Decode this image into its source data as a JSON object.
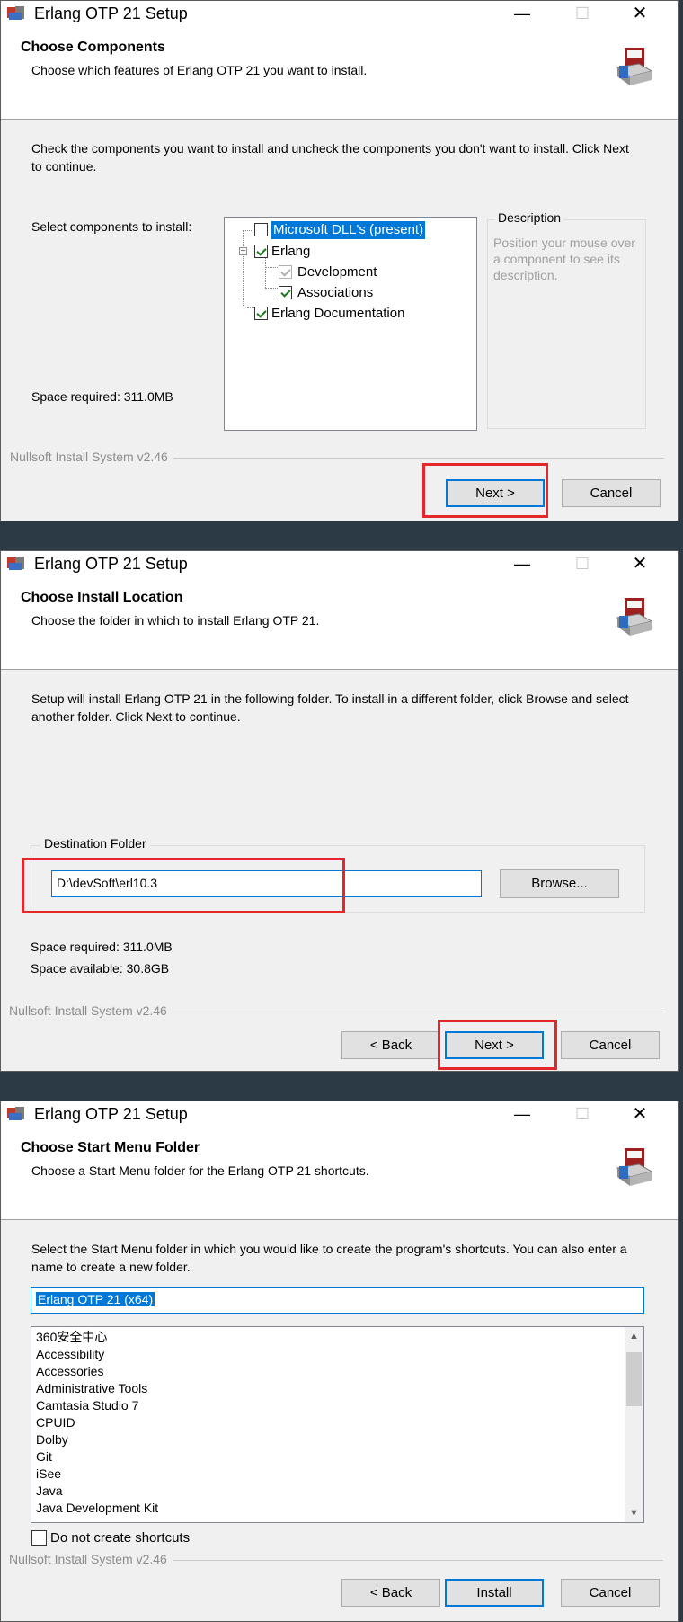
{
  "common": {
    "window_title": "Erlang OTP 21 Setup",
    "minimize_glyph": "—",
    "maximize_glyph": "☐",
    "close_glyph": "✕",
    "branding": "Nullsoft Install System v2.46",
    "highlight_color": "#e4272d",
    "accent_color": "#0078d7",
    "app_icon": "erlang-setup-icon",
    "header_icon": "installer-package-icon"
  },
  "step1": {
    "title": "Choose Components",
    "subtitle": "Choose which features of Erlang OTP 21 you want to install.",
    "instructions": "Check the components you want to install and uncheck the components you don't want to install. Click Next to continue.",
    "select_label": "Select components to install:",
    "components": [
      {
        "label": "Microsoft DLL's (present)",
        "checked": false,
        "selected": true
      },
      {
        "label": "Erlang",
        "checked": true,
        "expanded": true
      },
      {
        "label": "Development",
        "checked": true,
        "disabled": true
      },
      {
        "label": "Associations",
        "checked": true
      },
      {
        "label": "Erlang Documentation",
        "checked": true
      }
    ],
    "description_title": "Description",
    "description_text": "Position your mouse over a component to see its description.",
    "space_required": "Space required: 311.0MB",
    "next_label": "Next >",
    "cancel_label": "Cancel"
  },
  "step2": {
    "title": "Choose Install Location",
    "subtitle": "Choose the folder in which to install Erlang OTP 21.",
    "instructions": "Setup will install Erlang OTP 21 in the following folder. To install in a different folder, click Browse and select another folder. Click Next to continue.",
    "destination_label": "Destination Folder",
    "destination_value": "D:\\devSoft\\erl10.3",
    "browse_label": "Browse...",
    "space_required": "Space required: 311.0MB",
    "space_available": "Space available: 30.8GB",
    "back_label": "< Back",
    "next_label": "Next >",
    "cancel_label": "Cancel"
  },
  "step3": {
    "title": "Choose Start Menu Folder",
    "subtitle": "Choose a Start Menu folder for the Erlang OTP 21 shortcuts.",
    "instructions": "Select the Start Menu folder in which you would like to create the program's shortcuts. You can also enter a name to create a new folder.",
    "folder_value": "Erlang OTP 21 (x64)",
    "folders": [
      "360安全中心",
      "Accessibility",
      "Accessories",
      "Administrative Tools",
      "Camtasia Studio 7",
      "CPUID",
      "Dolby",
      "Git",
      "iSee",
      "Java",
      "Java Development Kit"
    ],
    "no_shortcuts_label": "Do not create shortcuts",
    "no_shortcuts_checked": false,
    "back_label": "< Back",
    "install_label": "Install",
    "cancel_label": "Cancel"
  }
}
